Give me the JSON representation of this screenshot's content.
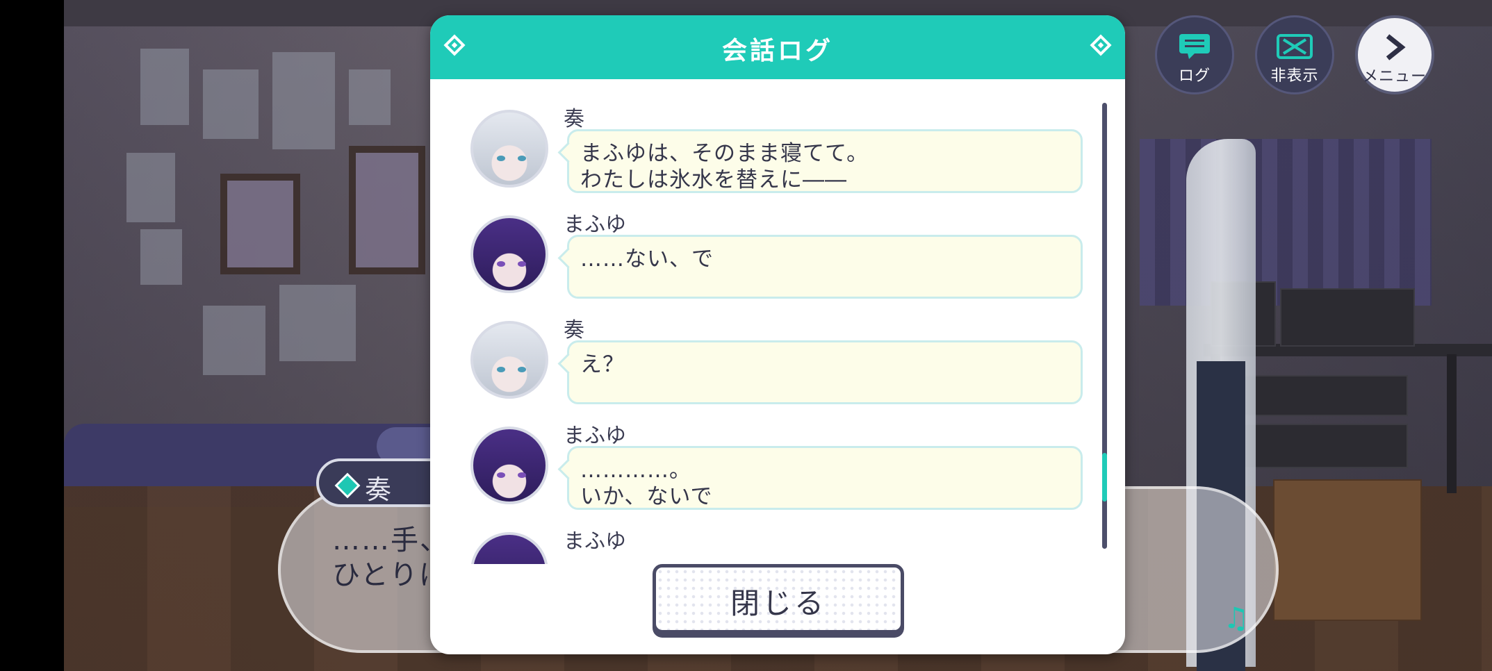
{
  "hud": {
    "log_label": "ログ",
    "hide_label": "非表示",
    "menu_label": "メニュー"
  },
  "dialogue_box": {
    "speaker": "奏",
    "line1": "……手、",
    "line2": "ひとりに"
  },
  "log_dialog": {
    "title": "会話ログ",
    "close_label": "閉じる",
    "entries": [
      {
        "speaker": "奏",
        "lines": [
          "まふゆは、そのまま寝てて。",
          "わたしは氷水を替えに――"
        ]
      },
      {
        "speaker": "まふゆ",
        "lines": [
          "……ない、で",
          ""
        ]
      },
      {
        "speaker": "奏",
        "lines": [
          "え？",
          ""
        ]
      },
      {
        "speaker": "まふゆ",
        "lines": [
          "…………。",
          "いか、ないで"
        ]
      },
      {
        "speaker": "まふゆ",
        "lines": [
          "",
          ""
        ]
      }
    ]
  },
  "colors": {
    "accent": "#1fcbb8",
    "bubble_fill": "#fdfde9",
    "bubble_border": "#c9ecec",
    "dark": "#3b3d58"
  }
}
